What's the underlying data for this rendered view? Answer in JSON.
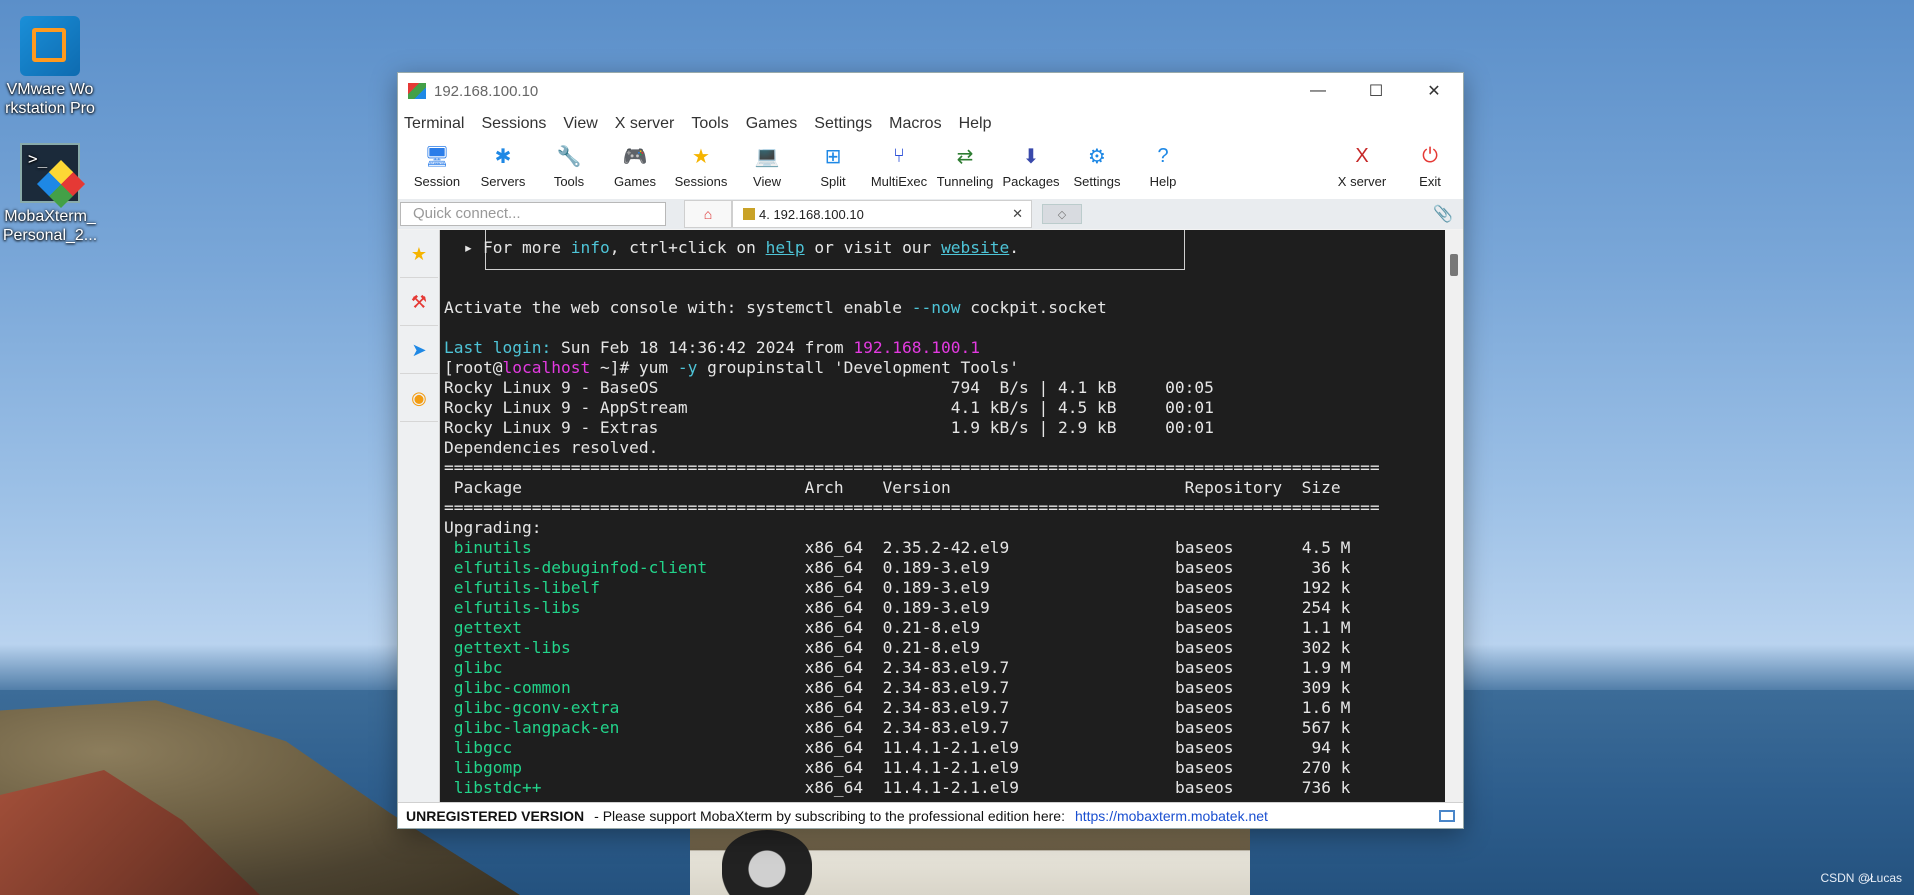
{
  "desktop": {
    "icons": [
      {
        "label": "VMware Workstation Pro",
        "line1": "VMware Wo",
        "line2": "rkstation Pro"
      },
      {
        "label": "MobaXterm_Personal_2...",
        "line1": "MobaXterm_",
        "line2": "Personal_2..."
      }
    ],
    "watermark": "CSDN @̷̷Lucas"
  },
  "window": {
    "title": "192.168.100.10",
    "controls": {
      "minimize": "—",
      "maximize": "☐",
      "close": "✕"
    },
    "menu": [
      "Terminal",
      "Sessions",
      "View",
      "X server",
      "Tools",
      "Games",
      "Settings",
      "Macros",
      "Help"
    ],
    "toolbar": [
      {
        "label": "Session",
        "icon": "session-icon",
        "glyph": "🖥",
        "color": "#2b7de9"
      },
      {
        "label": "Servers",
        "icon": "servers-icon",
        "glyph": "✱",
        "color": "#1e88e5"
      },
      {
        "label": "Tools",
        "icon": "tools-icon",
        "glyph": "🔧",
        "color": "#e53935"
      },
      {
        "label": "Games",
        "icon": "games-icon",
        "glyph": "🎮",
        "color": "#555"
      },
      {
        "label": "Sessions",
        "icon": "star-icon",
        "glyph": "★",
        "color": "#f5b400"
      },
      {
        "label": "View",
        "icon": "view-icon",
        "glyph": "💻",
        "color": "#3a9d3a"
      },
      {
        "label": "Split",
        "icon": "split-icon",
        "glyph": "⊞",
        "color": "#1e88e5"
      },
      {
        "label": "MultiExec",
        "icon": "multiexec-icon",
        "glyph": "⑂",
        "color": "#2b4fd8"
      },
      {
        "label": "Tunneling",
        "icon": "tunneling-icon",
        "glyph": "⇄",
        "color": "#2e7d32"
      },
      {
        "label": "Packages",
        "icon": "packages-icon",
        "glyph": "⬇",
        "color": "#3949ab"
      },
      {
        "label": "Settings",
        "icon": "settings-icon",
        "glyph": "⚙",
        "color": "#1e88e5"
      },
      {
        "label": "Help",
        "icon": "help-icon",
        "glyph": "?",
        "color": "#1e88e5"
      }
    ],
    "toolbar_right": [
      {
        "label": "X server",
        "icon": "xserver-icon",
        "glyph": "X",
        "color": "#c62828"
      },
      {
        "label": "Exit",
        "icon": "power-icon",
        "glyph": "⏻",
        "color": "#e53935"
      }
    ],
    "quick_connect_placeholder": "Quick connect...",
    "session_tab": {
      "label": "4. 192.168.100.10",
      "close": "✕"
    },
    "side_icons": [
      "star-icon",
      "tools-icon",
      "send-icon",
      "globe-icon"
    ],
    "status": {
      "bold": "UNREGISTERED VERSION",
      "text": " -  Please support MobaXterm by subscribing to the professional edition here:",
      "link": "https://mobaxterm.mobatek.net"
    }
  },
  "terminal": {
    "box_line": {
      "pre": "  ▸ For more ",
      "info": "info",
      "mid": ", ctrl+click on ",
      "help": "help",
      "mid2": " or visit our ",
      "website": "website",
      "post": "."
    },
    "activate": {
      "pre": "Activate the web console with: systemctl enable ",
      "flag": "--now",
      "post": " cockpit.socket"
    },
    "last_login": {
      "label": "Last login:",
      "text": " Sun Feb 18 14:36:42 2024 from ",
      "ip": "192.168.100.1"
    },
    "prompt": {
      "pre": "[root@",
      "host": "localhost",
      "mid": " ~]# yum ",
      "flag": "-y",
      "post": " groupinstall 'Development Tools'"
    },
    "repos": [
      "Rocky Linux 9 - BaseOS                              794  B/s | 4.1 kB     00:05",
      "Rocky Linux 9 - AppStream                           4.1 kB/s | 4.5 kB     00:01",
      "Rocky Linux 9 - Extras                              1.9 kB/s | 2.9 kB     00:01"
    ],
    "resolved": "Dependencies resolved.",
    "rule": "================================================================================================",
    "header": " Package                             Arch    Version                        Repository  Size",
    "upgrading": "Upgrading:",
    "packages": [
      {
        "name": "binutils",
        "arch": "x86_64",
        "version": "2.35.2-42.el9",
        "repo": "baseos",
        "size": "4.5 M"
      },
      {
        "name": "elfutils-debuginfod-client",
        "arch": "x86_64",
        "version": "0.189-3.el9",
        "repo": "baseos",
        "size": "36 k"
      },
      {
        "name": "elfutils-libelf",
        "arch": "x86_64",
        "version": "0.189-3.el9",
        "repo": "baseos",
        "size": "192 k"
      },
      {
        "name": "elfutils-libs",
        "arch": "x86_64",
        "version": "0.189-3.el9",
        "repo": "baseos",
        "size": "254 k"
      },
      {
        "name": "gettext",
        "arch": "x86_64",
        "version": "0.21-8.el9",
        "repo": "baseos",
        "size": "1.1 M"
      },
      {
        "name": "gettext-libs",
        "arch": "x86_64",
        "version": "0.21-8.el9",
        "repo": "baseos",
        "size": "302 k"
      },
      {
        "name": "glibc",
        "arch": "x86_64",
        "version": "2.34-83.el9.7",
        "repo": "baseos",
        "size": "1.9 M"
      },
      {
        "name": "glibc-common",
        "arch": "x86_64",
        "version": "2.34-83.el9.7",
        "repo": "baseos",
        "size": "309 k"
      },
      {
        "name": "glibc-gconv-extra",
        "arch": "x86_64",
        "version": "2.34-83.el9.7",
        "repo": "baseos",
        "size": "1.6 M"
      },
      {
        "name": "glibc-langpack-en",
        "arch": "x86_64",
        "version": "2.34-83.el9.7",
        "repo": "baseos",
        "size": "567 k"
      },
      {
        "name": "libgcc",
        "arch": "x86_64",
        "version": "11.4.1-2.1.el9",
        "repo": "baseos",
        "size": "94 k"
      },
      {
        "name": "libgomp",
        "arch": "x86_64",
        "version": "11.4.1-2.1.el9",
        "repo": "baseos",
        "size": "270 k"
      },
      {
        "name": "libstdc++",
        "arch": "x86_64",
        "version": "11.4.1-2.1.el9",
        "repo": "baseos",
        "size": "736 k"
      }
    ]
  }
}
